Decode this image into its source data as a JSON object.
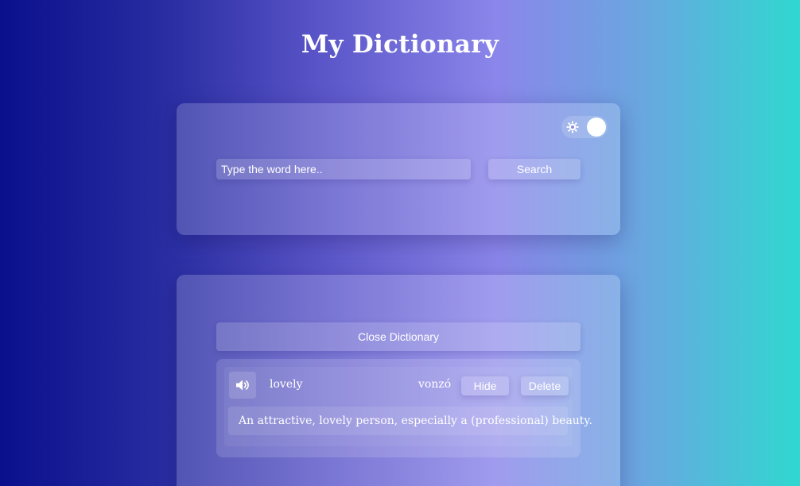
{
  "app": {
    "title": "My Dictionary"
  },
  "theme_toggle": {
    "icon": "sun-icon",
    "state": "on"
  },
  "search": {
    "placeholder": "Type the word here..",
    "value": "",
    "button_label": "Search"
  },
  "dictionary": {
    "close_label": "Close Dictionary",
    "entries": [
      {
        "speaker_icon": "speaker-icon",
        "word": "lovely",
        "translation": "vonzó",
        "hide_label": "Hide",
        "delete_label": "Delete",
        "definition": "An attractive, lovely person, especially a (professional) beauty."
      }
    ]
  }
}
